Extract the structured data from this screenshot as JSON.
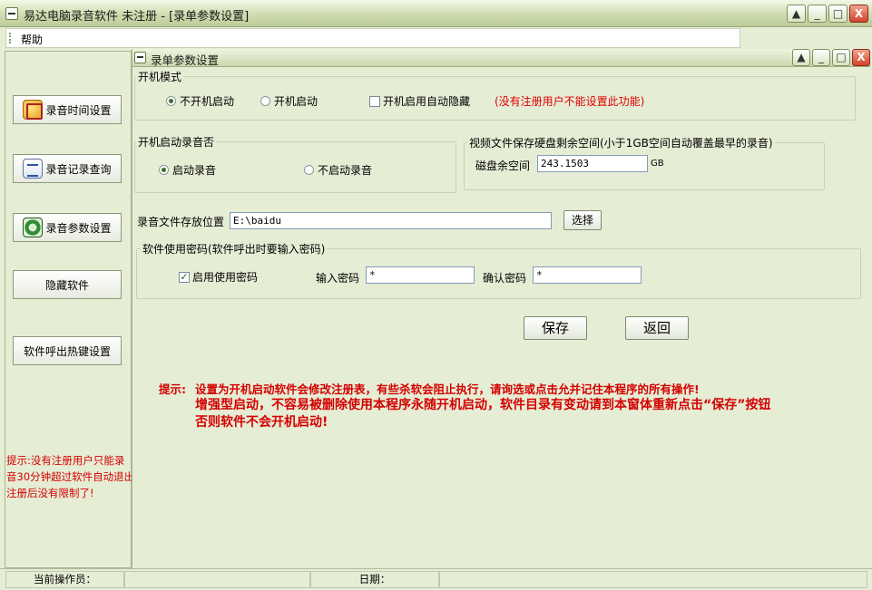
{
  "window": {
    "title": "易达电脑录音软件 未注册 - [录单参数设置]",
    "buttons": {
      "restore": "▲",
      "minimize": "_",
      "maximize": "□",
      "close": "X"
    }
  },
  "menu": {
    "items": [
      "帮助"
    ]
  },
  "sidebar": {
    "buttons": [
      {
        "label": "录音时间设置",
        "icon": "clock-icon"
      },
      {
        "label": "录音记录查询",
        "icon": "list-icon"
      },
      {
        "label": "录音参数设置",
        "icon": "gear-icon"
      },
      {
        "label": "隐藏软件",
        "icon": ""
      },
      {
        "label": "软件呼出热键设置",
        "icon": ""
      }
    ],
    "tip": "提示:没有注册用户只能录\n音30分钟超过软件自动退出\n注册后没有限制了!"
  },
  "child": {
    "title": "录单参数设置",
    "startup_mode": {
      "legend": "开机模式",
      "options": [
        "不开机启动",
        "开机启动"
      ],
      "selected": 0,
      "auto_hide_label": "开机启用自动隐藏",
      "auto_hide_checked": false,
      "unregistered_note": "(没有注册用户不能设置此功能)"
    },
    "startup_record": {
      "legend": "开机启动录音否",
      "options": [
        "启动录音",
        "不启动录音"
      ],
      "selected": 0
    },
    "disk": {
      "legend": "视频文件保存硬盘剩余空间(小于1GB空间自动覆盖最早的录音)",
      "label": "磁盘余空间",
      "value": "243.1503",
      "unit": "GB"
    },
    "storage": {
      "label": "录音文件存放位置",
      "path": "E:\\baidu",
      "choose_button": "选择"
    },
    "password": {
      "legend": "软件使用密码(软件呼出时要输入密码)",
      "enable_label": "启用使用密码",
      "enable_checked": true,
      "input_label": "输入密码",
      "input_value": "*",
      "confirm_label": "确认密码",
      "confirm_value": "*"
    },
    "save_button": "保存",
    "back_button": "返回",
    "hint": {
      "prefix": "提示:",
      "line1": "设置为开机启动软件会修改注册表，有些杀软会阻止执行，请询选或点击允并记住本程序的所有操作!",
      "line2": "增强型启动，不容易被删除使用本程序永随开机启动，软件目录有变动请到本窗体重新点击“保存”按钮",
      "line3": "否则软件不会开机启动!"
    }
  },
  "statusbar": {
    "operator_label": "当前操作员：",
    "operator_value": "",
    "date_label": "日期：",
    "date_value": ""
  }
}
